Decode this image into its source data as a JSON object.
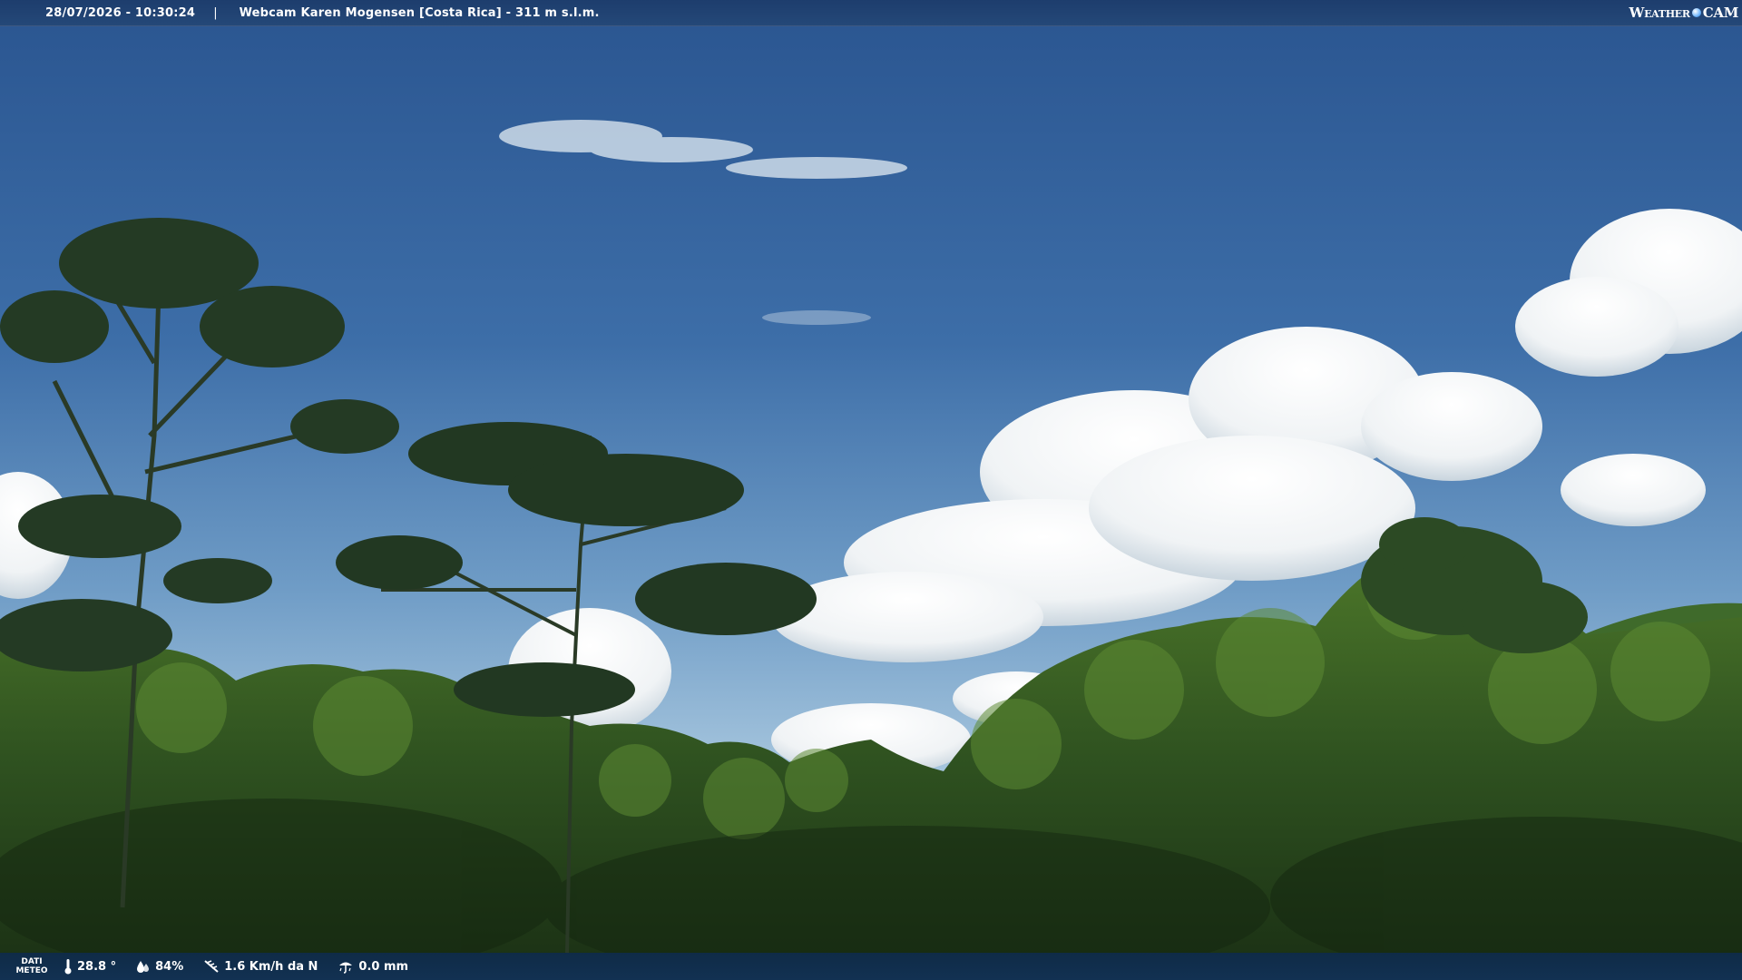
{
  "header": {
    "datetime": "28/07/2026 - 10:30:24",
    "separator": "|",
    "title": "Webcam Karen Mogensen [Costa Rica] - 311 m s.l.m.",
    "brand_weather": "Weather",
    "brand_cam": "CAM"
  },
  "footer": {
    "label_line1": "DATI",
    "label_line2": "METEO",
    "temperature": "28.8 °",
    "humidity": "84%",
    "wind": "1.6 Km/h da N",
    "rain": "0.0 mm"
  },
  "colors": {
    "bar_top": "#1d3d6d",
    "bar_bottom": "#123152",
    "sky_top": "#2d5a94",
    "sky_horizon": "#9fc2df",
    "forest": "#2f4f1c"
  },
  "icons": [
    "thermometer-icon",
    "humidity-drop-icon",
    "wind-icon",
    "rain-gauge-icon"
  ]
}
